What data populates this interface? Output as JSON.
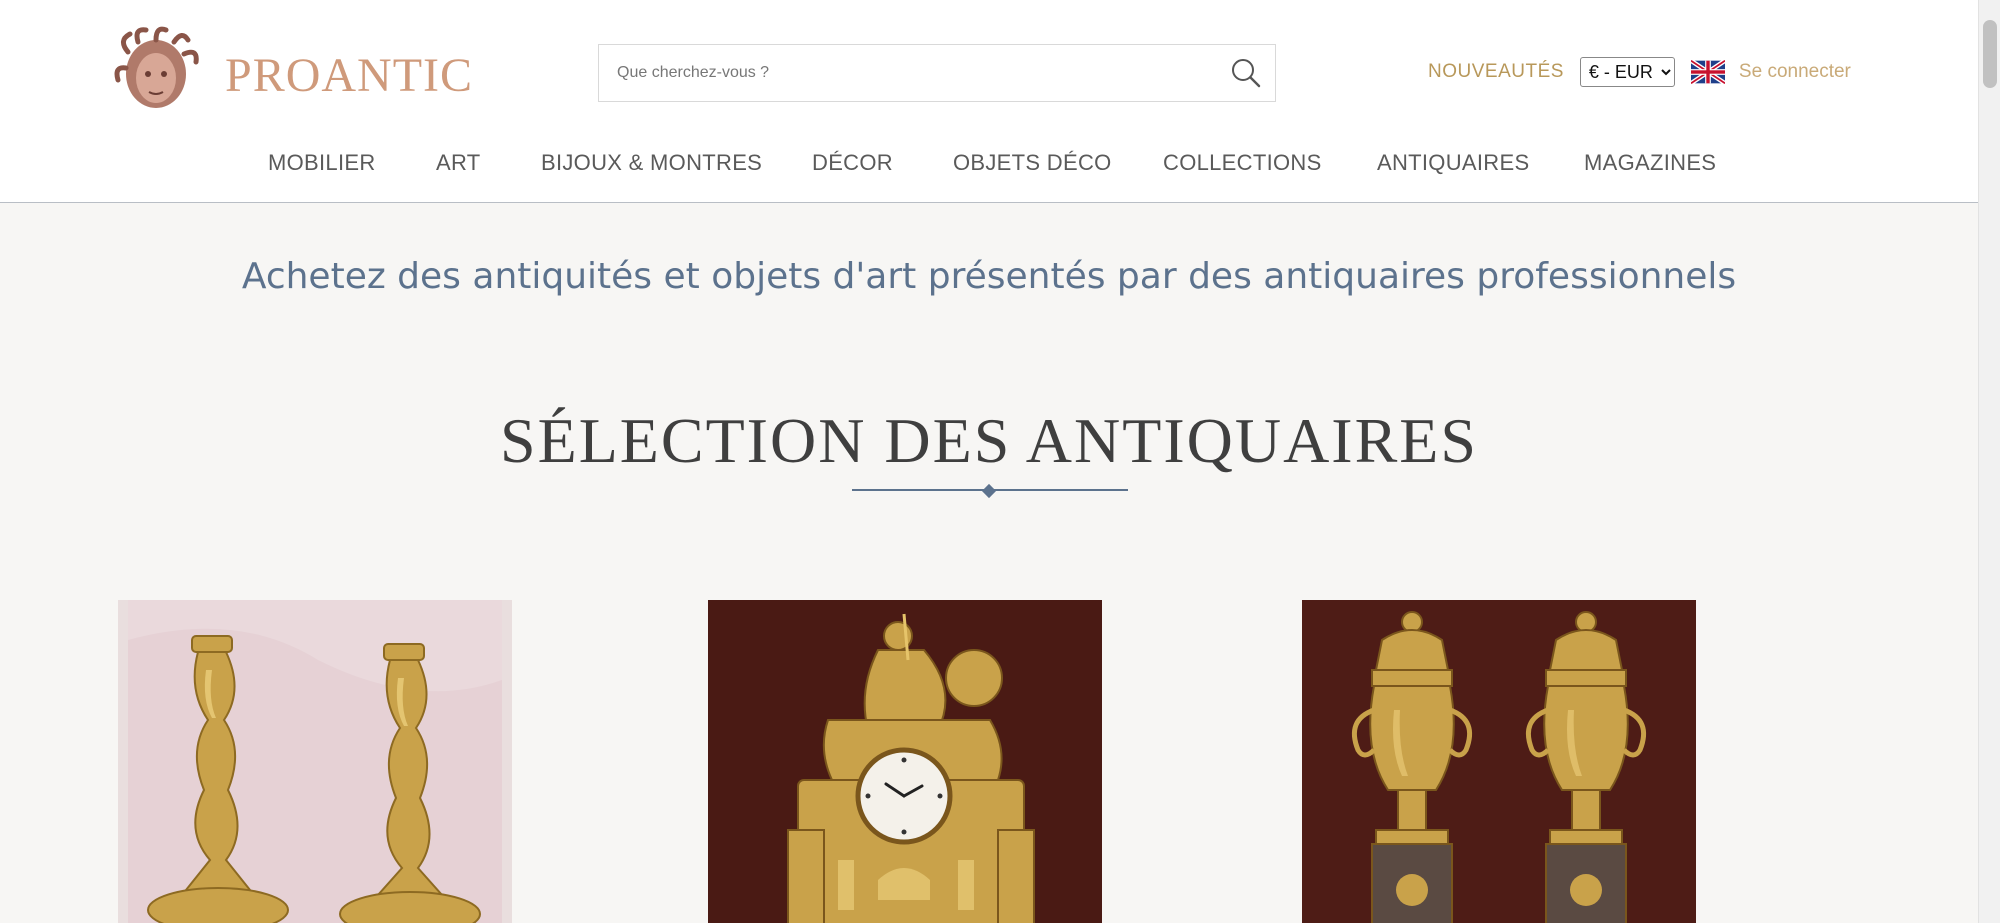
{
  "header": {
    "logo_text": "PROANTIC",
    "search": {
      "placeholder": "Que cherchez-vous ?",
      "value": ""
    },
    "new_link": "NOUVEAUTÉS",
    "currency": {
      "selected": "€ - EUR"
    },
    "login_link": "Se connecter"
  },
  "nav": {
    "items": [
      {
        "label": "MOBILIER"
      },
      {
        "label": "ART"
      },
      {
        "label": "BIJOUX & MONTRES"
      },
      {
        "label": "DÉCOR"
      },
      {
        "label": "OBJETS DÉCO"
      },
      {
        "label": "COLLECTIONS"
      },
      {
        "label": "ANTIQUAIRES"
      },
      {
        "label": "MAGAZINES"
      }
    ]
  },
  "tagline": "Achetez des antiquités et objets d'art présentés par des antiquaires professionnels",
  "section_title": "SÉLECTION DES ANTIQUAIRES",
  "colors": {
    "accent": "#5c728d",
    "gold": "#b8985a",
    "logo": "#cf9a7b",
    "page_background": "#f7f6f4"
  },
  "icons": {
    "search": "search-icon",
    "flag": "uk-flag-icon",
    "logo": "medusa-head-icon"
  }
}
